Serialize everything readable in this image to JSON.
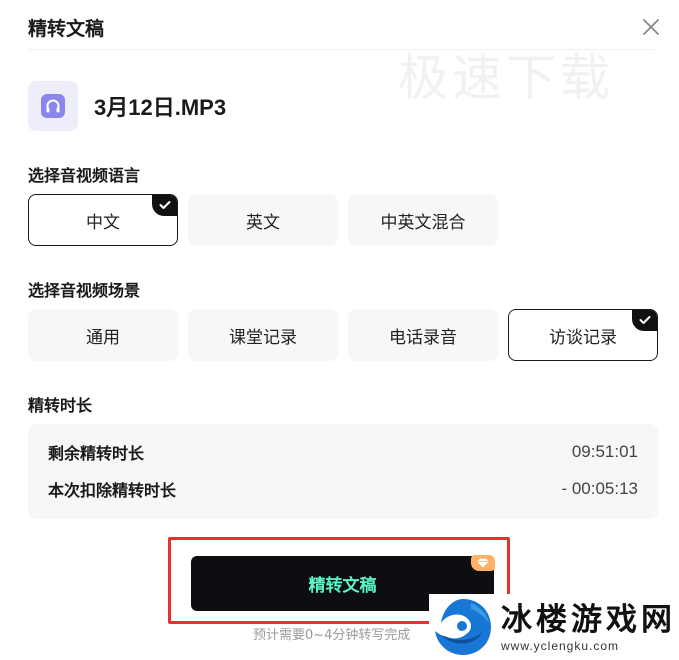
{
  "dialog": {
    "title": "精转文稿",
    "close_icon": "close-icon",
    "background_watermark": "极速下载"
  },
  "file": {
    "icon": "headphones-icon",
    "name": "3月12日.MP3"
  },
  "language": {
    "label": "选择音视频语言",
    "options": [
      "中文",
      "英文",
      "中英文混合"
    ],
    "selected": "中文"
  },
  "scene": {
    "label": "选择音视频场景",
    "options": [
      "通用",
      "课堂记录",
      "电话录音",
      "访谈记录"
    ],
    "selected": "访谈记录"
  },
  "duration": {
    "label": "精转时长",
    "remaining_label": "剩余精转时长",
    "remaining_value": "09:51:01",
    "deduct_label": "本次扣除精转时长",
    "deduct_value": "- 00:05:13"
  },
  "submit": {
    "label": "精转文稿",
    "badge_icon": "diamond-icon",
    "estimate": "预计需要0~4分钟转写完成"
  },
  "site_watermark": {
    "name": "冰楼游戏网",
    "url": "www.yclengku.com"
  },
  "colors": {
    "accent_text": "#5cf5c7",
    "button_bg": "#0d0d12",
    "highlight": "#e8312f",
    "badge": "#ffb067"
  }
}
